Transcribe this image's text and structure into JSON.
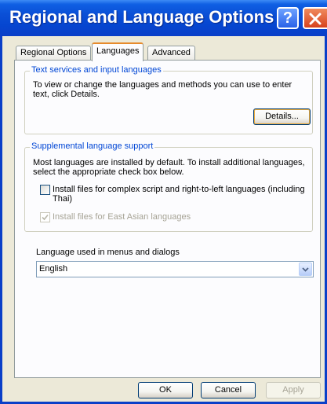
{
  "window": {
    "title": "Regional and Language Options",
    "help_label": "?"
  },
  "tabs": [
    {
      "label": "Regional Options",
      "active": false
    },
    {
      "label": "Languages",
      "active": true
    },
    {
      "label": "Advanced",
      "active": false
    }
  ],
  "text_services": {
    "legend": "Text services and input languages",
    "description_line1": "To view or change the languages and methods you can use to enter",
    "description_line2": "text, click Details.",
    "details_button": "Details..."
  },
  "supplemental": {
    "legend": "Supplemental language support",
    "description_line1": "Most languages are installed by default. To install additional languages,",
    "description_line2": "select the appropriate check box below.",
    "complex_script_line1": "Install files for complex script and right-to-left languages (including",
    "complex_script_line2": "Thai)",
    "complex_script_checked": false,
    "east_asian": "Install files for East Asian languages",
    "east_asian_checked": true
  },
  "ui_language": {
    "label": "Language used in menus and dialogs",
    "selected": "English"
  },
  "footer": {
    "ok": "OK",
    "cancel": "Cancel",
    "apply": "Apply"
  },
  "colors": {
    "title_bar": "#0a4fd6",
    "group_legend": "#0046d5",
    "active_tab_accent": "#e68b2c",
    "dialog_background": "#ece9d8"
  }
}
